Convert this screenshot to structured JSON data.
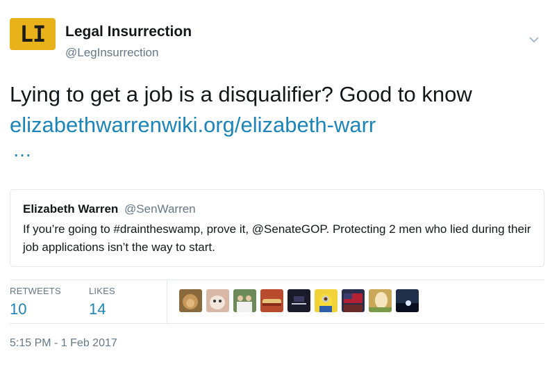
{
  "author": {
    "avatar_text": "LI",
    "name": "Legal Insurrection",
    "handle": "@LegInsurrection"
  },
  "tweet": {
    "text": "Lying to get a job is a disqualifier? Good to know ",
    "link_text": "elizabethwarrenwiki.org/elizabeth-warr",
    "ellipsis": "…"
  },
  "quoted": {
    "name": "Elizabeth Warren",
    "handle": "@SenWarren",
    "text": "If you’re going to #draintheswamp, prove it, @SenateGOP. Protecting 2 men who lied during their job applications isn’t the way to start."
  },
  "stats": {
    "retweets_label": "RETWEETS",
    "retweets_value": "10",
    "likes_label": "LIKES",
    "likes_value": "14"
  },
  "likers": [
    {
      "icon": "liker-avatar-lion",
      "bg": "#8a6a3c"
    },
    {
      "icon": "liker-avatar-cat",
      "bg": "#d9b8a8"
    },
    {
      "icon": "liker-avatar-family",
      "bg": "#6d8a5a"
    },
    {
      "icon": "liker-avatar-food",
      "bg": "#b84a2e"
    },
    {
      "icon": "liker-avatar-senate",
      "bg": "#1a1a2a"
    },
    {
      "icon": "liker-avatar-minion",
      "bg": "#f2d23a"
    },
    {
      "icon": "liker-avatar-flag",
      "bg": "#2b2e4a"
    },
    {
      "icon": "liker-avatar-horse",
      "bg": "#c9a85a"
    },
    {
      "icon": "liker-avatar-sky",
      "bg": "#20304a"
    }
  ],
  "timestamp": "5:15 PM - 1 Feb 2017",
  "colors": {
    "link": "#1b85ba",
    "muted": "#657786",
    "avatar_bg": "#e8b21a"
  }
}
